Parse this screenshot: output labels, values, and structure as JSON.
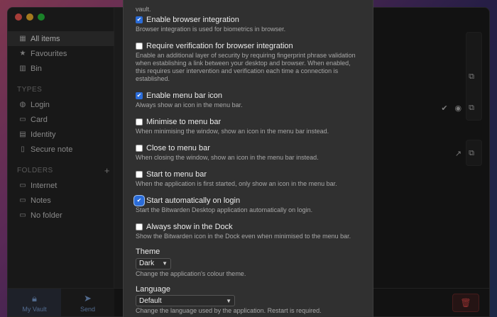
{
  "sidebar": {
    "items": [
      {
        "label": "All items",
        "icon": "grid-icon"
      },
      {
        "label": "Favourites",
        "icon": "star-icon"
      },
      {
        "label": "Bin",
        "icon": "trash-icon"
      }
    ],
    "types_header": "TYPES",
    "types": [
      {
        "label": "Login",
        "icon": "globe-icon"
      },
      {
        "label": "Card",
        "icon": "credit-card-icon"
      },
      {
        "label": "Identity",
        "icon": "id-card-icon"
      },
      {
        "label": "Secure note",
        "icon": "note-icon"
      }
    ],
    "folders_header": "FOLDERS",
    "folders": [
      {
        "label": "Internet",
        "icon": "folder-icon"
      },
      {
        "label": "Notes",
        "icon": "folder-icon"
      },
      {
        "label": "No folder",
        "icon": "folder-icon"
      }
    ],
    "bottom": {
      "vault": "My Vault",
      "send": "Send"
    }
  },
  "modal": {
    "clipped_text": "vault.",
    "options": [
      {
        "label": "Enable browser integration",
        "checked": true,
        "desc": "Browser integration is used for biometrics in browser."
      },
      {
        "label": "Require verification for browser integration",
        "checked": false,
        "desc": "Enable an additional layer of security by requiring fingerprint phrase validation when establishing a link between your desktop and browser. When enabled, this requires user intervention and verification each time a connection is established."
      },
      {
        "label": "Enable menu bar icon",
        "checked": true,
        "desc": "Always show an icon in the menu bar."
      },
      {
        "label": "Minimise to menu bar",
        "checked": false,
        "desc": "When minimising the window, show an icon in the menu bar instead."
      },
      {
        "label": "Close to menu bar",
        "checked": false,
        "desc": "When closing the window, show an icon in the menu bar instead."
      },
      {
        "label": "Start to menu bar",
        "checked": false,
        "desc": "When the application is first started, only show an icon in the menu bar."
      },
      {
        "label": "Start automatically on login",
        "checked": true,
        "desc": "Start the Bitwarden Desktop application automatically on login."
      },
      {
        "label": "Always show in the Dock",
        "checked": false,
        "desc": "Show the Bitwarden icon in the Dock even when minimised to the menu bar."
      }
    ],
    "theme": {
      "label": "Theme",
      "value": "Dark",
      "desc": "Change the application's colour theme."
    },
    "language": {
      "label": "Language",
      "value": "Default",
      "desc": "Change the language used by the application. Restart is required."
    }
  },
  "colors": {
    "accent": "#2b6cd8",
    "danger": "#e24a4a"
  }
}
